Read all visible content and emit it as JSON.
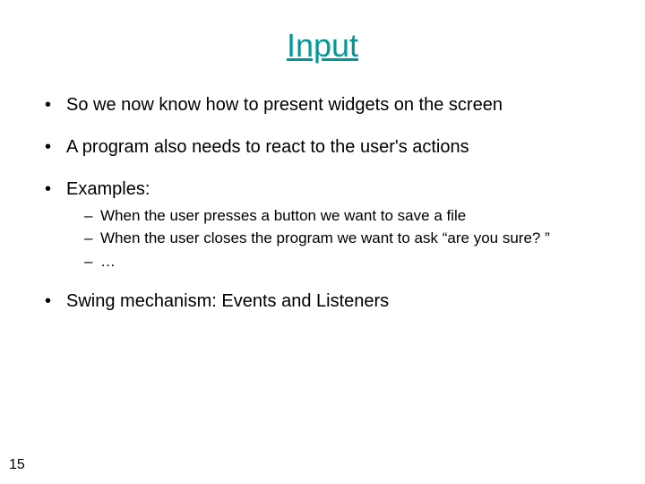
{
  "title": "Input",
  "bullets": {
    "b1": "So we now know how to present widgets on the screen",
    "b2": "A program also needs to react to the user's actions",
    "b3": "Examples:",
    "b3_sub": {
      "s1": "When the user presses a button we want to save a file",
      "s2": "When the user closes the program we want to ask “are you sure? ”",
      "s3": "…"
    },
    "b4": "Swing mechanism: Events and Listeners"
  },
  "page_number": "15"
}
